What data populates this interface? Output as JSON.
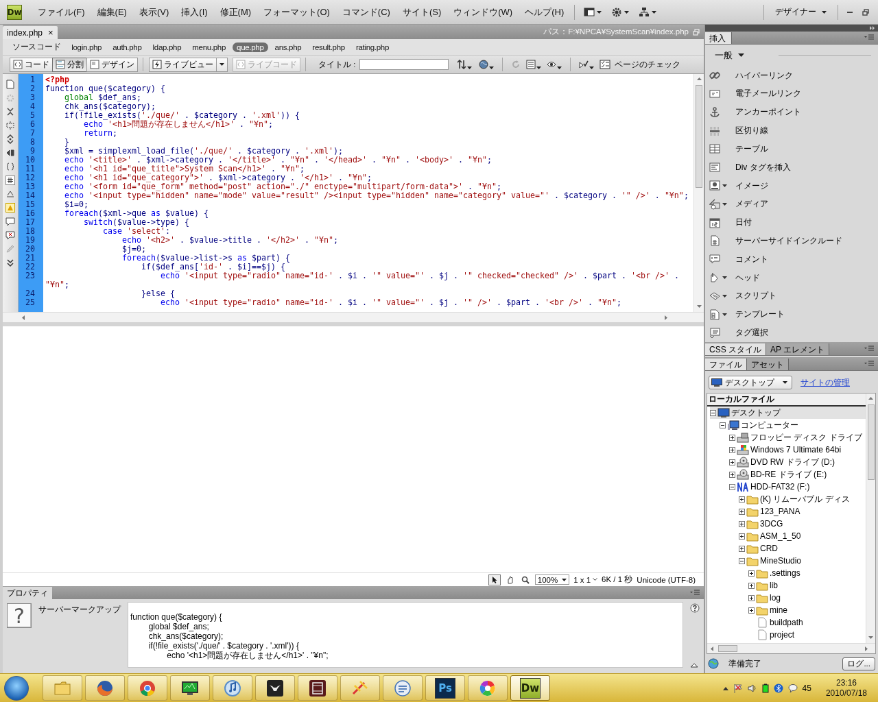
{
  "app": {
    "logo": "Dw",
    "menus": [
      "ファイル(F)",
      "編集(E)",
      "表示(V)",
      "挿入(I)",
      "修正(M)",
      "フォーマット(O)",
      "コマンド(C)",
      "サイト(S)",
      "ウィンドウ(W)",
      "ヘルプ(H)"
    ],
    "workspace": "デザイナー"
  },
  "document": {
    "tab": {
      "label": "index.php",
      "close": "×"
    },
    "path": "パス：F:¥NPCA¥SystemScan¥index.php",
    "related_files": [
      {
        "label": "ソースコード",
        "selected": false
      },
      {
        "label": "login.php",
        "selected": false
      },
      {
        "label": "auth.php",
        "selected": false
      },
      {
        "label": "ldap.php",
        "selected": false
      },
      {
        "label": "menu.php",
        "selected": false
      },
      {
        "label": "que.php",
        "selected": true
      },
      {
        "label": "ans.php",
        "selected": false
      },
      {
        "label": "result.php",
        "selected": false
      },
      {
        "label": "rating.php",
        "selected": false
      }
    ],
    "view_buttons": [
      {
        "label": "コード",
        "selected": false
      },
      {
        "label": "分割",
        "selected": true
      },
      {
        "label": "デザイン",
        "selected": false
      }
    ],
    "live_buttons": [
      {
        "label": "ライブビュー",
        "disabled": false
      },
      {
        "label": "ライブコード",
        "disabled": true
      }
    ],
    "title_label": "タイトル :",
    "check_page": "ページのチェック"
  },
  "code": {
    "lines": [
      {
        "number": "1",
        "segments": [
          {
            "kind": "php",
            "text": "<?php"
          }
        ]
      },
      {
        "number": "2",
        "segments": [
          {
            "kind": "code",
            "text": "function que($category) {"
          }
        ]
      },
      {
        "number": "3",
        "segments": [
          {
            "kind": "glob",
            "text": "    global"
          },
          {
            "kind": "code",
            "text": " $def_ans;"
          }
        ]
      },
      {
        "number": "4",
        "segments": [
          {
            "kind": "code",
            "text": "    chk_ans($category);"
          }
        ]
      },
      {
        "number": "5",
        "segments": [
          {
            "kind": "code",
            "text": "    if(!file_exists("
          },
          {
            "kind": "str",
            "text": "'./que/'"
          },
          {
            "kind": "code",
            "text": " . $category . "
          },
          {
            "kind": "str",
            "text": "'.xml'"
          },
          {
            "kind": "code",
            "text": ")) {"
          }
        ]
      },
      {
        "number": "6",
        "segments": [
          {
            "kind": "kw",
            "text": "        echo "
          },
          {
            "kind": "str",
            "text": "'<h1>問題が存在しません</h1>'"
          },
          {
            "kind": "code",
            "text": " . "
          },
          {
            "kind": "str",
            "text": "\"¥n\""
          },
          {
            "kind": "code",
            "text": ";"
          }
        ]
      },
      {
        "number": "7",
        "segments": [
          {
            "kind": "kw",
            "text": "        return"
          },
          {
            "kind": "code",
            "text": ";"
          }
        ]
      },
      {
        "number": "8",
        "segments": [
          {
            "kind": "code",
            "text": "    }"
          }
        ]
      },
      {
        "number": "9",
        "segments": [
          {
            "kind": "code",
            "text": "    $xml = simplexml_load_file("
          },
          {
            "kind": "str",
            "text": "'./que/'"
          },
          {
            "kind": "code",
            "text": " . $category . "
          },
          {
            "kind": "str",
            "text": "'.xml'"
          },
          {
            "kind": "code",
            "text": ");"
          }
        ]
      },
      {
        "number": "10",
        "segments": [
          {
            "kind": "kw",
            "text": "    echo "
          },
          {
            "kind": "str",
            "text": "'<title>'"
          },
          {
            "kind": "code",
            "text": " . $xml->category . "
          },
          {
            "kind": "str",
            "text": "'</title>'"
          },
          {
            "kind": "code",
            "text": " . "
          },
          {
            "kind": "str",
            "text": "\"¥n\""
          },
          {
            "kind": "code",
            "text": " . "
          },
          {
            "kind": "str",
            "text": "'</head>'"
          },
          {
            "kind": "code",
            "text": " . "
          },
          {
            "kind": "str",
            "text": "\"¥n\""
          },
          {
            "kind": "code",
            "text": " . "
          },
          {
            "kind": "str",
            "text": "'<body>'"
          },
          {
            "kind": "code",
            "text": " . "
          },
          {
            "kind": "str",
            "text": "\"¥n\""
          },
          {
            "kind": "code",
            "text": ";"
          }
        ]
      },
      {
        "number": "11",
        "segments": [
          {
            "kind": "kw",
            "text": "    echo "
          },
          {
            "kind": "str",
            "text": "'<h1 id=\"que_title\">System Scan</h1>'"
          },
          {
            "kind": "code",
            "text": " . "
          },
          {
            "kind": "str",
            "text": "\"¥n\""
          },
          {
            "kind": "code",
            "text": ";"
          }
        ]
      },
      {
        "number": "12",
        "segments": [
          {
            "kind": "kw",
            "text": "    echo "
          },
          {
            "kind": "str",
            "text": "'<h1 id=\"que_category\">'"
          },
          {
            "kind": "code",
            "text": " . $xml->category . "
          },
          {
            "kind": "str",
            "text": "'</h1>'"
          },
          {
            "kind": "code",
            "text": " . "
          },
          {
            "kind": "str",
            "text": "\"¥n\""
          },
          {
            "kind": "code",
            "text": ";"
          }
        ]
      },
      {
        "number": "13",
        "segments": [
          {
            "kind": "kw",
            "text": "    echo "
          },
          {
            "kind": "str",
            "text": "'<form id=\"que_form\" method=\"post\" action=\"./\" enctype=\"multipart/form-data\">'"
          },
          {
            "kind": "code",
            "text": " . "
          },
          {
            "kind": "str",
            "text": "\"¥n\""
          },
          {
            "kind": "code",
            "text": ";"
          }
        ]
      },
      {
        "number": "14",
        "segments": [
          {
            "kind": "kw",
            "text": "    echo "
          },
          {
            "kind": "str",
            "text": "'<input type=\"hidden\" name=\"mode\" value=\"result\" /><input type=\"hidden\" name=\"category\" value=\"'"
          },
          {
            "kind": "code",
            "text": " . $category . "
          },
          {
            "kind": "str",
            "text": "'\" />'"
          },
          {
            "kind": "code",
            "text": " . "
          },
          {
            "kind": "str",
            "text": "\"¥n\""
          },
          {
            "kind": "code",
            "text": ";"
          }
        ]
      },
      {
        "number": "15",
        "segments": [
          {
            "kind": "code",
            "text": "    $i=0;"
          }
        ]
      },
      {
        "number": "16",
        "segments": [
          {
            "kind": "kw",
            "text": "    foreach"
          },
          {
            "kind": "code",
            "text": "($xml->que "
          },
          {
            "kind": "kw",
            "text": "as"
          },
          {
            "kind": "code",
            "text": " $value) {"
          }
        ]
      },
      {
        "number": "17",
        "segments": [
          {
            "kind": "kw",
            "text": "        switch"
          },
          {
            "kind": "code",
            "text": "($value->type) {"
          }
        ]
      },
      {
        "number": "18",
        "segments": [
          {
            "kind": "kw",
            "text": "            case "
          },
          {
            "kind": "str",
            "text": "'select'"
          },
          {
            "kind": "code",
            "text": ":"
          }
        ]
      },
      {
        "number": "19",
        "segments": [
          {
            "kind": "kw",
            "text": "                echo "
          },
          {
            "kind": "str",
            "text": "'<h2>'"
          },
          {
            "kind": "code",
            "text": " . $value->title . "
          },
          {
            "kind": "str",
            "text": "'</h2>'"
          },
          {
            "kind": "code",
            "text": " . "
          },
          {
            "kind": "str",
            "text": "\"¥n\""
          },
          {
            "kind": "code",
            "text": ";"
          }
        ]
      },
      {
        "number": "20",
        "segments": [
          {
            "kind": "code",
            "text": "                $j=0;"
          }
        ]
      },
      {
        "number": "21",
        "segments": [
          {
            "kind": "kw",
            "text": "                foreach"
          },
          {
            "kind": "code",
            "text": "($value->list->s "
          },
          {
            "kind": "kw",
            "text": "as"
          },
          {
            "kind": "code",
            "text": " $part) {"
          }
        ]
      },
      {
        "number": "22",
        "segments": [
          {
            "kind": "code",
            "text": "                    if($def_ans["
          },
          {
            "kind": "str",
            "text": "'id-'"
          },
          {
            "kind": "code",
            "text": " . $i]==$j) {"
          }
        ]
      },
      {
        "number": "23",
        "segments": [
          {
            "kind": "kw",
            "text": "                        echo "
          },
          {
            "kind": "str",
            "text": "'<input type=\"radio\" name=\"id-'"
          },
          {
            "kind": "code",
            "text": " . $i . "
          },
          {
            "kind": "str",
            "text": "'\" value=\"'"
          },
          {
            "kind": "code",
            "text": " . $j . "
          },
          {
            "kind": "str",
            "text": "'\" checked=\"checked\" />'"
          },
          {
            "kind": "code",
            "text": " . $part . "
          },
          {
            "kind": "str",
            "text": "'<br />'"
          },
          {
            "kind": "code",
            "text": " . "
          },
          {
            "kind": "str",
            "text": "\"¥n\""
          },
          {
            "kind": "code",
            "text": ";"
          }
        ]
      },
      {
        "number": "24",
        "segments": [
          {
            "kind": "code",
            "text": "                    }else {"
          }
        ]
      },
      {
        "number": "25",
        "segments": [
          {
            "kind": "kw",
            "text": "                        echo "
          },
          {
            "kind": "str",
            "text": "'<input type=\"radio\" name=\"id-'"
          },
          {
            "kind": "code",
            "text": " . $i . "
          },
          {
            "kind": "str",
            "text": "'\" value=\"'"
          },
          {
            "kind": "code",
            "text": " . $j . "
          },
          {
            "kind": "str",
            "text": "'\" />'"
          },
          {
            "kind": "code",
            "text": " . $part . "
          },
          {
            "kind": "str",
            "text": "'<br />'"
          },
          {
            "kind": "code",
            "text": " . "
          },
          {
            "kind": "str",
            "text": "\"¥n\""
          },
          {
            "kind": "code",
            "text": ";"
          }
        ]
      }
    ]
  },
  "status": {
    "zoom": "100%",
    "window_size": "1 x 1",
    "download": "6K / 1 秒",
    "encoding": "Unicode (UTF-8)"
  },
  "properties": {
    "title": "プロパティ",
    "glyph": "?",
    "label": "サーバーマークアップ",
    "markup": [
      "function que($category) {",
      "\tglobal $def_ans;",
      "\tchk_ans($category);",
      "\tif(!file_exists('./que/' . $category . '.xml')) {",
      "\t\techo '<h1>問題が存在しません</h1>' . \"¥n\";"
    ]
  },
  "insert_panel": {
    "tab": "挿入",
    "category": "一般",
    "items": [
      {
        "label": "ハイパーリンク",
        "has_menu": false
      },
      {
        "label": "電子メールリンク",
        "has_menu": false
      },
      {
        "label": "アンカーポイント",
        "has_menu": false
      },
      {
        "label": "区切り線",
        "has_menu": false
      },
      {
        "label": "テーブル",
        "has_menu": false
      },
      {
        "label": "Div タグを挿入",
        "has_menu": false
      },
      {
        "label": "イメージ",
        "has_menu": true
      },
      {
        "label": "メディア",
        "has_menu": true
      },
      {
        "label": "日付",
        "has_menu": false
      },
      {
        "label": "サーバーサイドインクルード",
        "has_menu": false
      },
      {
        "label": "コメント",
        "has_menu": false
      },
      {
        "label": "ヘッド",
        "has_menu": true
      },
      {
        "label": "スクリプト",
        "has_menu": true
      },
      {
        "label": "テンプレート",
        "has_menu": true
      },
      {
        "label": "タグ選択",
        "has_menu": false
      }
    ]
  },
  "style_tabs": [
    {
      "label": "CSS スタイル",
      "selected": true
    },
    {
      "label": "AP エレメント",
      "selected": false
    }
  ],
  "files_panel": {
    "tabs": [
      {
        "label": "ファイル",
        "selected": true
      },
      {
        "label": "アセット",
        "selected": false
      }
    ],
    "site": "デスクトップ",
    "manage_link": "サイトの管理",
    "header": "ローカルファイル",
    "tree": [
      {
        "label": "デスクトップ",
        "kind": "desktop",
        "expanded": true,
        "selected": true,
        "children": [
          {
            "label": "コンピューター",
            "kind": "computer",
            "expanded": true,
            "selected": false,
            "children": [
              {
                "label": "フロッピー ディスク ドライブ",
                "kind": "floppy",
                "expanded": false,
                "selected": false
              },
              {
                "label": "Windows 7 Ultimate 64bi",
                "kind": "windows",
                "expanded": false,
                "selected": false
              },
              {
                "label": "DVD RW ドライブ (D:)",
                "kind": "disc",
                "expanded": false,
                "selected": false
              },
              {
                "label": "BD-RE ドライブ (E:)",
                "kind": "disc",
                "expanded": false,
                "selected": false
              },
              {
                "label": "HDD-FAT32 (F:)",
                "kind": "hdd",
                "expanded": true,
                "selected": false,
                "children": [
                  {
                    "label": "(K) リムーバブル ディス",
                    "kind": "folder",
                    "expanded": false,
                    "selected": false
                  },
                  {
                    "label": "123_PANA",
                    "kind": "folder",
                    "expanded": false,
                    "selected": false
                  },
                  {
                    "label": "3DCG",
                    "kind": "folder",
                    "expanded": false,
                    "selected": false
                  },
                  {
                    "label": "ASM_1_50",
                    "kind": "folder",
                    "expanded": false,
                    "selected": false
                  },
                  {
                    "label": "CRD",
                    "kind": "folder",
                    "expanded": false,
                    "selected": false
                  },
                  {
                    "label": "MineStudio",
                    "kind": "folder",
                    "expanded": true,
                    "selected": false,
                    "children": [
                      {
                        "label": ".settings",
                        "kind": "folder",
                        "expanded": false,
                        "selected": false
                      },
                      {
                        "label": "lib",
                        "kind": "folder",
                        "expanded": false,
                        "selected": false
                      },
                      {
                        "label": "log",
                        "kind": "folder",
                        "expanded": false,
                        "selected": false
                      },
                      {
                        "label": "mine",
                        "kind": "folder",
                        "expanded": false,
                        "selected": false
                      },
                      {
                        "label": "buildpath",
                        "kind": "file",
                        "selected": false
                      },
                      {
                        "label": "project",
                        "kind": "file",
                        "selected": false
                      }
                    ]
                  }
                ]
              }
            ]
          }
        ]
      }
    ],
    "status": "準備完了",
    "log_button": "ログ..."
  },
  "taskbar": {
    "apps": [
      {
        "kind": "folder",
        "selected": false
      },
      {
        "kind": "firefox",
        "selected": false
      },
      {
        "kind": "chrome",
        "selected": false
      },
      {
        "kind": "monitor",
        "selected": false
      },
      {
        "kind": "music",
        "selected": false
      },
      {
        "kind": "whale",
        "selected": false
      },
      {
        "kind": "film",
        "selected": false
      },
      {
        "kind": "tool",
        "selected": false
      },
      {
        "kind": "chat",
        "selected": false
      },
      {
        "kind": "badge",
        "label": "Ps",
        "selected": false
      },
      {
        "kind": "pinwheel",
        "selected": false
      },
      {
        "kind": "badge",
        "label": "Dw",
        "selected": true
      }
    ],
    "tray_text": "45",
    "time": "23:16",
    "date": "2010/07/18"
  }
}
